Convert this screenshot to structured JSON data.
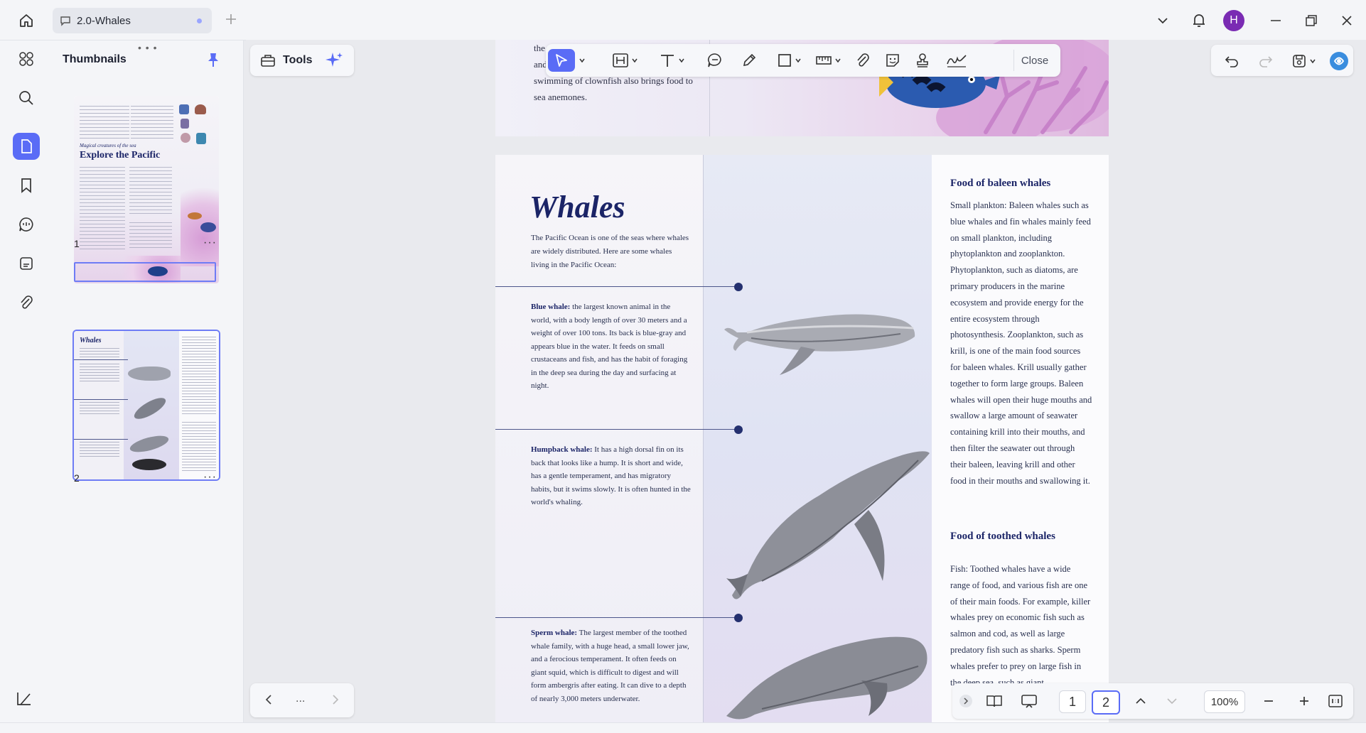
{
  "window": {
    "tab_title": "2.0-Whales",
    "avatar_letter": "H",
    "accent_color": "#5a6cf6"
  },
  "sidebar": {
    "title": "Thumbnails",
    "pages": [
      {
        "number": "1",
        "thumb_heading": "Explore the Pacific",
        "thumb_sub": "Magical creatures of the sea"
      },
      {
        "number": "2",
        "thumb_heading": "Whales"
      }
    ]
  },
  "toolbar": {
    "tools_label": "Tools",
    "close_label": "Close"
  },
  "page1": {
    "text_lines": [
      "the",
      "and",
      "swimming of clownfish also brings food to",
      "sea anemones."
    ]
  },
  "page2": {
    "title": "Whales",
    "intro": "The Pacific Ocean is one of the seas where whales are widely distributed. Here are some whales living in the Pacific Ocean:",
    "entries": [
      {
        "name": "Blue whale:",
        "text": " the largest known animal in the world, with a body length of over 30 meters and a weight of over 100 tons. Its back is blue-gray and appears blue in the water. It feeds on small crustaceans and fish, and has the habit of foraging in the deep sea during the day and surfacing at night."
      },
      {
        "name": "Humpback whale:",
        "text": " It has a high dorsal fin on its back that looks like a hump. It is short and wide, has a gentle temperament, and has migratory habits, but it swims slowly. It is often hunted in the world's whaling."
      },
      {
        "name": "Sperm whale:",
        "text": " The largest member of the toothed whale family, with a huge head, a small lower jaw, and a ferocious temperament. It often feeds on giant squid, which is difficult to digest and will form ambergris after eating. It can dive to a depth of nearly 3,000 meters underwater."
      }
    ],
    "right_heading_1": "Food of baleen whales",
    "right_text_1": "Small plankton: Baleen whales such as blue whales and fin whales mainly feed on small plankton, including phytoplankton and zooplankton. Phytoplankton, such as diatoms, are primary producers in the marine ecosystem and provide energy for the entire ecosystem through photosynthesis. Zooplankton, such as krill, is one of the main food sources for baleen whales. Krill usually gather together to form large groups. Baleen whales will open their huge mouths and swallow a large amount of seawater containing krill into their mouths, and then filter the seawater out through their baleen, leaving krill and other food in their mouths and swallowing it.",
    "right_heading_2": "Food of toothed whales",
    "right_text_2": "Fish: Toothed whales have a wide range of food, and various fish are one of their main foods. For example, killer whales prey on economic fish such as salmon and cod, as well as large predatory fish such as sharks. Sperm whales prefer to prey on large fish in the deep sea, such as giant"
  },
  "pagebar": {
    "page_1": "1",
    "page_2": "2",
    "zoom": "100%"
  },
  "navbar": {
    "more": "..."
  },
  "icons": [
    "home-icon",
    "chat-icon",
    "plus-icon",
    "chevron-down-icon",
    "bell-icon",
    "minimize-icon",
    "restore-icon",
    "close-icon",
    "apps-icon",
    "search-icon",
    "page-icon",
    "bookmark-icon",
    "comment-icon",
    "form-icon",
    "attachment-icon",
    "pin-icon",
    "toolbox-icon",
    "sparkle-icon",
    "select-icon",
    "textbox-icon",
    "text-icon",
    "note-icon",
    "pencil-icon",
    "rectangle-icon",
    "measure-icon",
    "paperclip-icon",
    "sticker-icon",
    "stamp-icon",
    "signature-icon",
    "undo-icon",
    "redo-icon",
    "save-icon",
    "assistant-icon"
  ]
}
